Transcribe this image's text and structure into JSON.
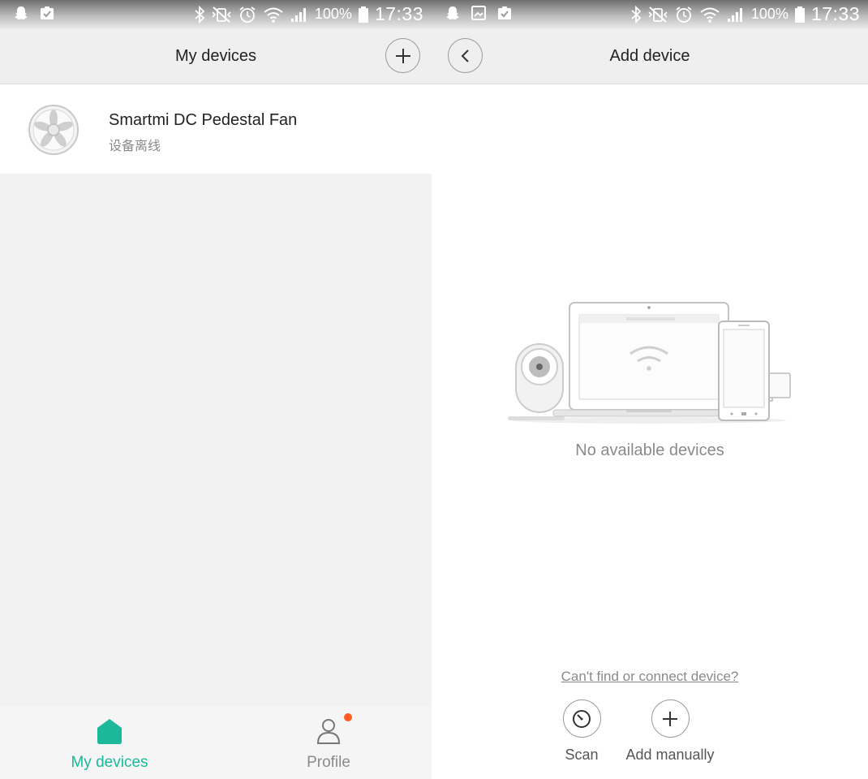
{
  "status_bar": {
    "battery": "100%",
    "time": "17:33"
  },
  "left": {
    "header": {
      "title": "My devices"
    },
    "devices": [
      {
        "name": "Smartmi DC Pedestal Fan",
        "status": "设备离线"
      }
    ],
    "tabs": [
      {
        "label": "My devices",
        "active": true
      },
      {
        "label": "Profile",
        "active": false,
        "has_badge": true
      }
    ]
  },
  "right": {
    "header": {
      "title": "Add device"
    },
    "empty_text": "No available devices",
    "help_link": "Can't find or connect device?",
    "actions": [
      {
        "label": "Scan",
        "icon": "scan-icon"
      },
      {
        "label": "Add manually",
        "icon": "plus-icon"
      }
    ]
  },
  "colors": {
    "accent": "#1bb89a",
    "badge": "#ff5a1f",
    "inactive": "#8a8a8a"
  }
}
